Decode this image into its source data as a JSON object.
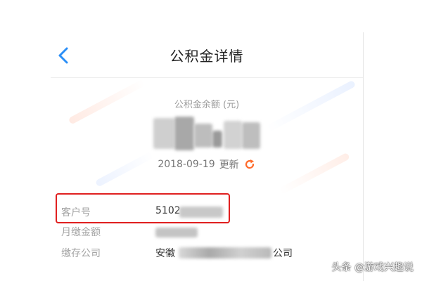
{
  "header": {
    "title": "公积金详情",
    "back_icon": "chevron-left-icon"
  },
  "balance": {
    "label": "公积金余额 (元)",
    "value_blurred": true
  },
  "update": {
    "date": "2018-09-19",
    "link_label": "更新",
    "refresh_icon": "refresh-icon",
    "accent_color": "#ff6a2a"
  },
  "details": {
    "customer_no": {
      "label": "客户号",
      "value_prefix": "5102"
    },
    "monthly_payment": {
      "label": "月缴金额"
    },
    "company": {
      "label": "缴存公司",
      "value_prefix": "安徽",
      "value_suffix": "公司"
    }
  },
  "colors": {
    "back_icon": "#2b8ff7",
    "highlight_border": "#e02020"
  },
  "watermark": {
    "text": "头条 @游戏兴趣说"
  }
}
